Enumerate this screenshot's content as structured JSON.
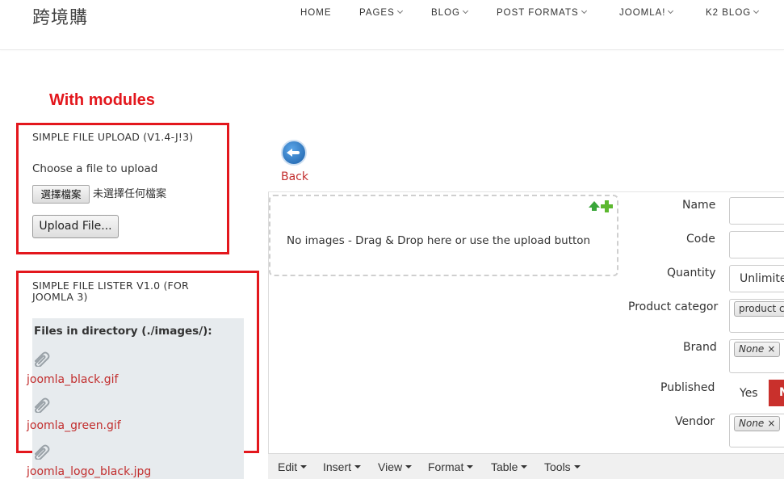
{
  "site": {
    "logo": "跨境購"
  },
  "nav": [
    {
      "label": "HOME",
      "dropdown": false
    },
    {
      "label": "PAGES",
      "dropdown": true
    },
    {
      "label": "BLOG",
      "dropdown": true
    },
    {
      "label": "POST FORMATS",
      "dropdown": true
    },
    {
      "label": "JOOMLA!",
      "dropdown": true
    },
    {
      "label": "K2 BLOG",
      "dropdown": true
    }
  ],
  "annotation": {
    "text": "With modules",
    "color": "#e3171d"
  },
  "upload_module": {
    "title": "SIMPLE FILE UPLOAD (V1.4-J!3)",
    "choose_label": "Choose a file to upload",
    "file_button": "選擇檔案",
    "no_file_text": "未選擇任何檔案",
    "upload_button": "Upload File..."
  },
  "lister_module": {
    "title": "SIMPLE FILE LISTER V1.0 (FOR JOOMLA 3)",
    "heading": "Files in directory (./images/):",
    "files": [
      "joomla_black.gif",
      "joomla_green.gif",
      "joomla_logo_black.jpg"
    ],
    "icon": "paperclip-icon",
    "link_color": "#c22e2e"
  },
  "admin": {
    "back_label": "Back",
    "dropzone_text": "No images - Drag & Drop here or use the upload button",
    "fields": {
      "name": {
        "label": "Name",
        "value": ""
      },
      "code": {
        "label": "Code",
        "value": ""
      },
      "quantity": {
        "label": "Quantity",
        "value": "Unlimite"
      },
      "category": {
        "label": "Product categor",
        "chip": "product c"
      },
      "brand": {
        "label": "Brand",
        "chip": "None",
        "remove": "×"
      },
      "published": {
        "label": "Published",
        "yes": "Yes",
        "no": "N"
      },
      "vendor": {
        "label": "Vendor",
        "chip": "None",
        "remove": "×"
      }
    },
    "editor_menu": [
      "Edit",
      "Insert",
      "View",
      "Format",
      "Table",
      "Tools"
    ]
  }
}
